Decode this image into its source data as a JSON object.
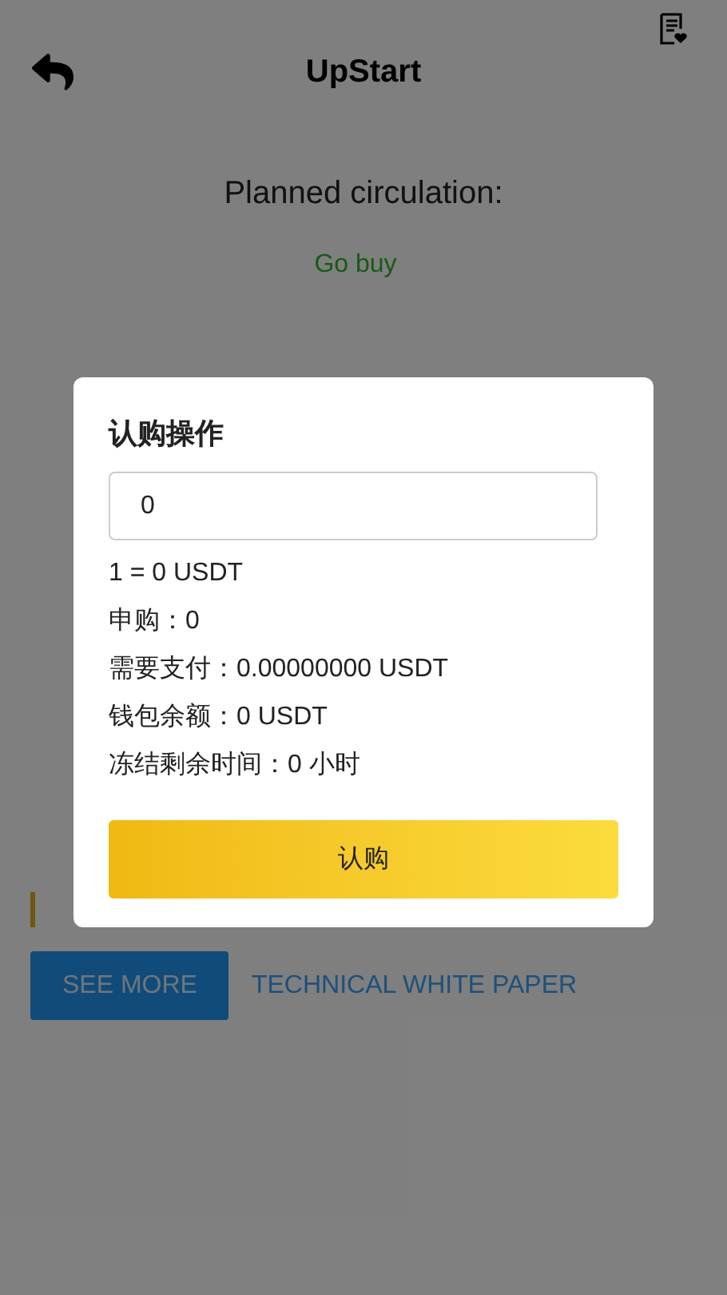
{
  "header": {
    "title": "UpStart"
  },
  "info": {
    "planned_circulation": "Planned circulation:",
    "go_buy": "Go buy"
  },
  "buttons": {
    "see_more": "SEE MORE",
    "white_paper": "TECHNICAL WHITE PAPER"
  },
  "dialog": {
    "title": "认购操作",
    "amount_value": "0",
    "lines": [
      "1 = 0 USDT",
      "申购：0",
      "需要支付：0.00000000 USDT",
      "钱包余额：0 USDT",
      "冻结剩余时间：0 小时"
    ],
    "submit": "认购"
  }
}
